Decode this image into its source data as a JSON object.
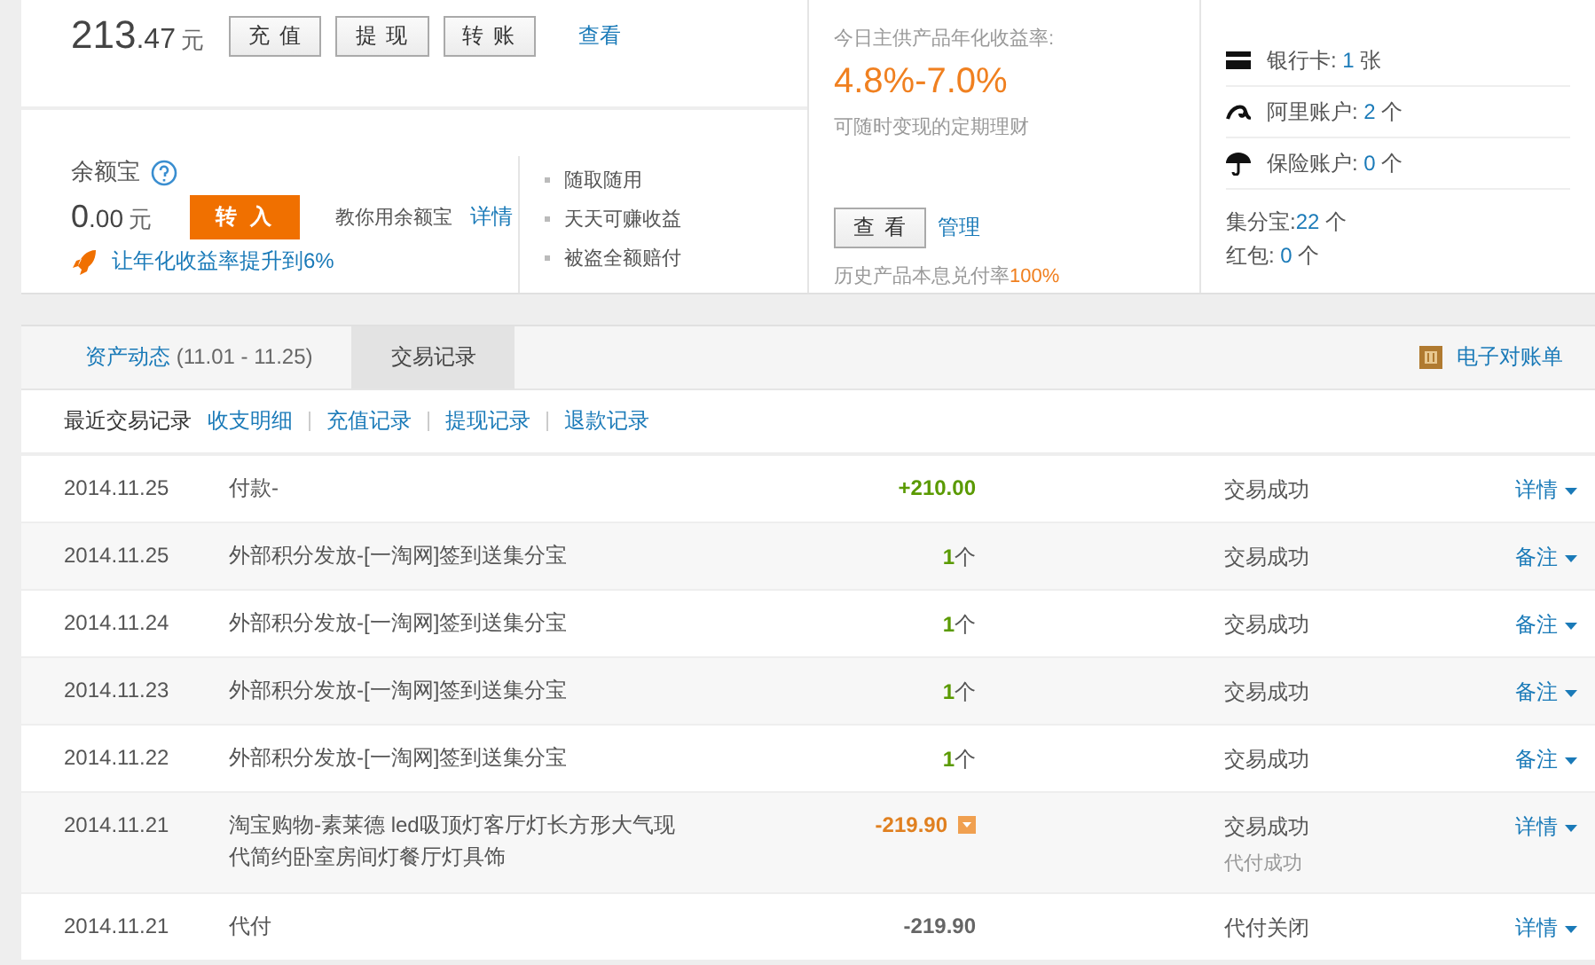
{
  "balance": {
    "integer": "213",
    "decimal": ".47",
    "unit": "元",
    "buttons": [
      "充 值",
      "提 现",
      "转 账"
    ],
    "link": "查看"
  },
  "yuebao": {
    "title": "余额宝",
    "integer": "0",
    "decimal": ".00",
    "unit": "元",
    "button": "转 入",
    "hint": "教你用余额宝",
    "hint_link": "详情",
    "promo": "让年化收益率提升到6%",
    "features": [
      "随取随用",
      "天天可赚收益",
      "被盗全额赔付"
    ]
  },
  "fund": {
    "caption": "今日主供产品年化收益率:",
    "rate": "4.8%-7.0%",
    "subtitle": "可随时变现的定期理财",
    "button": "查 看",
    "link": "管理",
    "history": "历史产品本息兑付率",
    "history_rate": "100%"
  },
  "accounts": {
    "items": [
      {
        "kind": "card",
        "label": "银行卡: ",
        "count": "1",
        "unit": " 张"
      },
      {
        "kind": "ali",
        "label": "阿里账户: ",
        "count": "2",
        "unit": " 个"
      },
      {
        "kind": "insurance",
        "label": "保险账户: ",
        "count": "0",
        "unit": " 个"
      }
    ],
    "extras": [
      {
        "label": "集分宝:",
        "count": "22",
        "unit": " 个"
      },
      {
        "label": "红包: ",
        "count": "0",
        "unit": " 个"
      }
    ]
  },
  "records": {
    "tabs": [
      {
        "label": "资产动态",
        "range": " (11.01 - 11.25)",
        "selected": false
      },
      {
        "label": "交易记录",
        "selected": true
      }
    ],
    "statement": "电子对账单",
    "subnav": {
      "title": "最近交易记录",
      "links": [
        "收支明细",
        "充值记录",
        "提现记录",
        "退款记录"
      ]
    },
    "rows": [
      {
        "date": "2014.11.25",
        "desc": "付款-",
        "amount": "+210.00",
        "color": "#5a9a00",
        "status": "交易成功",
        "action": "详情"
      },
      {
        "date": "2014.11.25",
        "desc": "外部积分发放-[一淘网]签到送集分宝",
        "amount": "1",
        "unit": "个",
        "color": "#5a9a00",
        "status": "交易成功",
        "action": "备注"
      },
      {
        "date": "2014.11.24",
        "desc": "外部积分发放-[一淘网]签到送集分宝",
        "amount": "1",
        "unit": "个",
        "color": "#5a9a00",
        "status": "交易成功",
        "action": "备注"
      },
      {
        "date": "2014.11.23",
        "desc": "外部积分发放-[一淘网]签到送集分宝",
        "amount": "1",
        "unit": "个",
        "color": "#5a9a00",
        "status": "交易成功",
        "action": "备注"
      },
      {
        "date": "2014.11.22",
        "desc": "外部积分发放-[一淘网]签到送集分宝",
        "amount": "1",
        "unit": "个",
        "color": "#5a9a00",
        "status": "交易成功",
        "action": "备注"
      },
      {
        "date": "2014.11.21",
        "desc": "淘宝购物-素莱德 led吸顶灯客厅灯长方形大气现代简约卧室房间灯餐厅灯具饰",
        "amount": "-219.90",
        "color": "#e08020",
        "expandable": true,
        "status": "交易成功",
        "substatus": "代付成功",
        "action": "详情"
      },
      {
        "date": "2014.11.21",
        "desc": "代付",
        "amount": "-219.90",
        "color": "#666666",
        "status": "代付关闭",
        "action": "详情"
      }
    ]
  }
}
